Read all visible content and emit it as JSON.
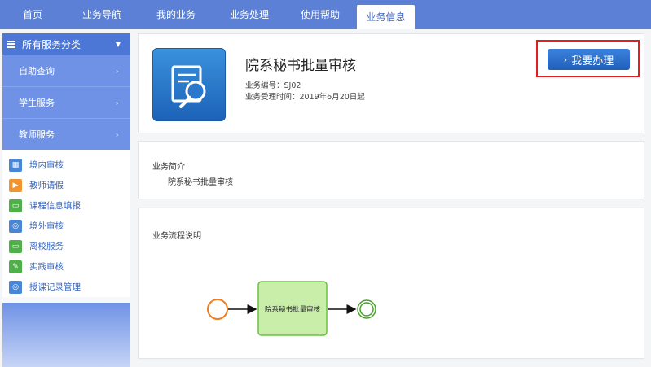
{
  "nav": {
    "tabs": [
      "首页",
      "业务导航",
      "我的业务",
      "业务处理",
      "使用帮助",
      "业务信息"
    ],
    "active_index": 5
  },
  "sidebar": {
    "header": "所有服务分类",
    "categories": [
      "自助查询",
      "学生服务",
      "教师服务"
    ],
    "items": [
      {
        "label": "境内审核",
        "icon": "calendar-icon",
        "color": "blue"
      },
      {
        "label": "教师请假",
        "icon": "play-icon",
        "color": "orange"
      },
      {
        "label": "课程信息填报",
        "icon": "monitor-icon",
        "color": "green"
      },
      {
        "label": "境外审核",
        "icon": "user-icon",
        "color": "blue"
      },
      {
        "label": "离校服务",
        "icon": "monitor-icon",
        "color": "green"
      },
      {
        "label": "实践审核",
        "icon": "edit-icon",
        "color": "green"
      },
      {
        "label": "授课记录管理",
        "icon": "user-icon",
        "color": "blue"
      }
    ]
  },
  "business": {
    "title": "院系秘书批量审核",
    "code": "业务编号：SJ02",
    "time": "业务受理时间：2019年6月20日起",
    "apply_label": "我要办理"
  },
  "intro": {
    "label": "业务简介",
    "text": "院系秘书批量审核"
  },
  "flow": {
    "label": "业务流程说明",
    "task": "院系秘书批量审核"
  },
  "colors": {
    "nav": "#5b80d6",
    "accent": "#3c82dc",
    "highlight": "#e02020",
    "task_fill": "#c8eeaa",
    "task_stroke": "#6cc040",
    "start_stroke": "#ef7d22",
    "end_stroke": "#4aa02c"
  }
}
